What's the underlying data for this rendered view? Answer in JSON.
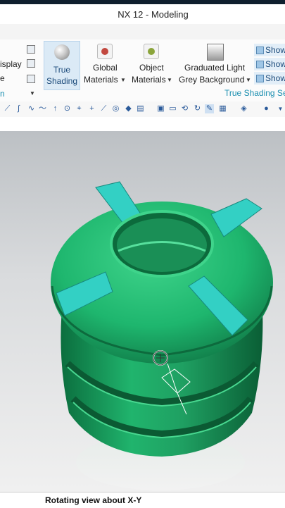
{
  "window": {
    "title": "NX 12 - Modeling"
  },
  "ribbon": {
    "display_label": "isplay",
    "e_label": "e",
    "n_label": "n",
    "true_shading": {
      "line1": "True",
      "line2": "Shading"
    },
    "global_materials": {
      "line1": "Global",
      "line2": "Materials"
    },
    "object_materials": {
      "line1": "Object",
      "line2": "Materials"
    },
    "graduated_light": {
      "line1": "Graduated Light",
      "line2": "Grey Background"
    },
    "show_buttons": [
      "Show",
      "Show",
      "Show"
    ],
    "group_label": "True Shading Se",
    "colors": {
      "accent": "#1b8fb0",
      "selected_bg": "#dbeaf6"
    }
  },
  "toolbar": {
    "icons": [
      "line-icon",
      "curve-icon",
      "spline-icon",
      "wave-icon",
      "arrow-icon",
      "circle-target-icon",
      "snap-icon",
      "plus-icon",
      "diagonal-icon",
      "globe-icon",
      "eraser-icon",
      "book-icon",
      "view-front-icon",
      "view-image-icon",
      "rotate-icon",
      "refresh-icon",
      "brush-icon",
      "select-icon",
      "grid-icon",
      "layers-icon",
      "sphere-icon",
      "dropdown-icon"
    ]
  },
  "viewport": {
    "model": "water-tank-3d-model",
    "model_color": "#1eb66e",
    "rib_color": "#33d0c4",
    "background_top": "#bcc0c4",
    "background_bottom": "#f0f0f0"
  },
  "status": {
    "text": "Rotating view about X-Y"
  }
}
